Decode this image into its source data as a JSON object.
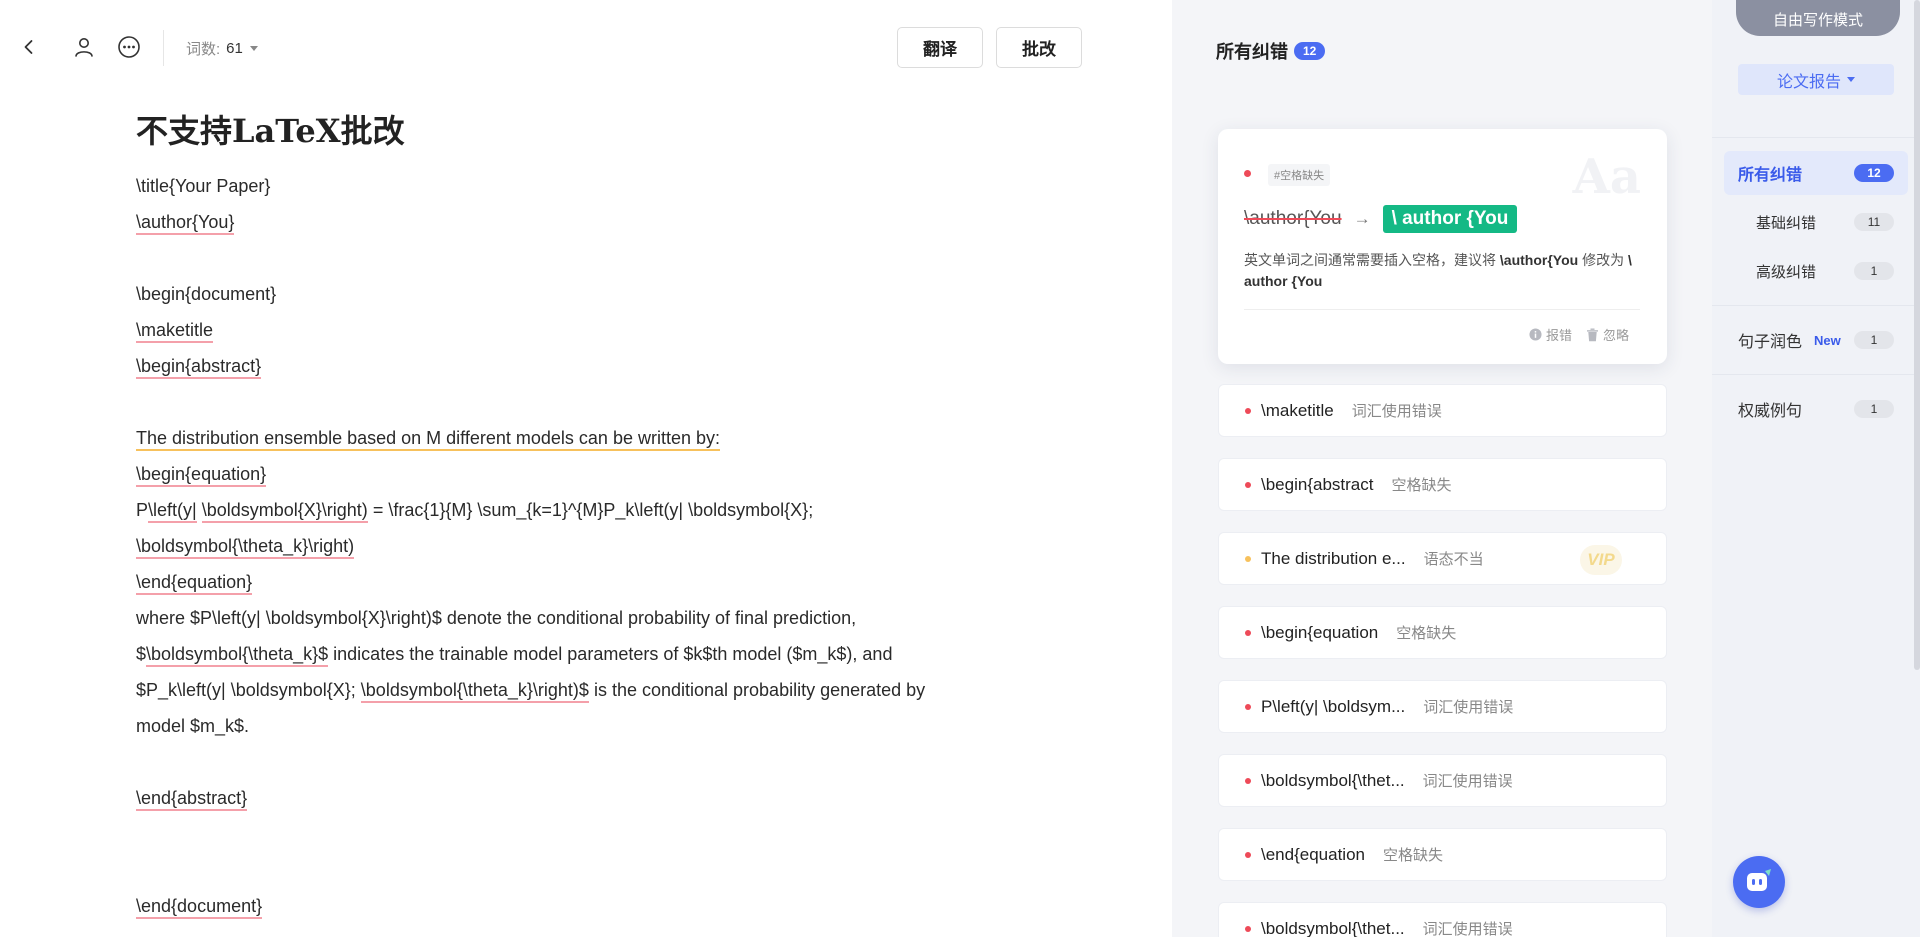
{
  "toolbar": {
    "word_count_label": "词数:",
    "word_count": "61",
    "translate_label": "翻译",
    "revise_label": "批改"
  },
  "document": {
    "title": "不支持LaTeX批改",
    "lines": [
      "\\title{Your Paper}",
      "\\author{You}",
      "",
      "\\begin{document}",
      "\\maketitle",
      "\\begin{abstract}",
      "",
      "The distribution ensemble based on M different models can be written by:",
      "\\begin{equation}",
      "P\\left(y| \\boldsymbol{X}\\right) = \\frac{1}{M} \\sum_{k=1}^{M}P_k\\left(y| \\boldsymbol{X};",
      "\\boldsymbol{\\theta_k}\\right)",
      "\\end{equation}",
      "where $P\\left(y| \\boldsymbol{X}\\right)$ denote the conditional probability of final prediction,",
      "$\\boldsymbol{\\theta_k}$ indicates the trainable model parameters of $k$th model ($m_k$), and",
      "$P_k\\left(y| \\boldsymbol{X}; \\boldsymbol{\\theta_k}\\right)$ is the conditional probability generated by",
      "model $m_k$.",
      "",
      "\\end{abstract}",
      "",
      "",
      "\\end{document}"
    ],
    "segments": {
      "l1_a": "\\title{Your Paper}",
      "l2_a": "\\author{You}",
      "l4_a": "\\begin{document}",
      "l5_a": "\\maketitle",
      "l6_a": "\\begin{abstract}",
      "l8_a": "The distribution ensemble based on M different models can be written by:",
      "l9_a": "\\begin{equation}",
      "l10_a": "P",
      "l10_b": "\\left(y|",
      "l10_c": " ",
      "l10_d": "\\boldsymbol{X}\\right)",
      "l10_e": " = \\frac{1}{M} \\sum_{k=1}^{M}P_k\\left(y| \\boldsymbol{X};",
      "l11_a": "\\boldsymbol{\\theta_k}\\right)",
      "l12_a": "\\end{equation}",
      "l13_a": "where $P\\left(y| \\boldsymbol{X}\\right)$ denote the conditional probability of final prediction,",
      "l14_a": "$",
      "l14_b": "\\boldsymbol{\\theta_k}$",
      "l14_c": " indicates the trainable model parameters of $k$th model ($m_k$), and",
      "l15_a": "$P_k\\left(y| \\boldsymbol{X}; ",
      "l15_b": "\\boldsymbol{\\theta_k}\\right)$",
      "l15_c": " is the conditional probability generated by",
      "l16_a": "model $m_k$.",
      "l18_a": "\\end{abstract}",
      "l21_a": "\\end{document}"
    }
  },
  "corrections": {
    "title": "所有纠错",
    "count": "12",
    "featured": {
      "tag": "#空格缺失",
      "original": "\\author{You",
      "suggestion": "\\ author {You",
      "desc_prefix": "英文单词之间通常需要插入空格，建议将 ",
      "desc_from": "\\author{You",
      "desc_middle": " 修改为 ",
      "desc_to": "\\ author {You",
      "report_label": "报错",
      "ignore_label": "忽略",
      "watermark": "Aa"
    },
    "items": [
      {
        "text": "\\maketitle",
        "type": "词汇使用错误"
      },
      {
        "text": "\\begin{abstract",
        "type": "空格缺失"
      },
      {
        "text": "The distribution e...",
        "type": "语态不当",
        "vip": "VIP"
      },
      {
        "text": "\\begin{equation",
        "type": "空格缺失"
      },
      {
        "text": "P\\left(y| \\boldsym...",
        "type": "词汇使用错误"
      },
      {
        "text": "\\boldsymbol{\\thet...",
        "type": "词汇使用错误"
      },
      {
        "text": "\\end{equation",
        "type": "空格缺失"
      },
      {
        "text": "\\boldsymbol{\\thet...",
        "type": "词汇使用错误"
      }
    ]
  },
  "right_nav": {
    "mode_label": "自由写作模式",
    "report_label": "论文报告",
    "items": [
      {
        "label": "所有纠错",
        "count": "12"
      },
      {
        "label": "基础纠错",
        "count": "11"
      },
      {
        "label": "高级纠错",
        "count": "1"
      },
      {
        "label": "句子润色",
        "count": "1",
        "badge": "New"
      },
      {
        "label": "权威例句",
        "count": "1"
      }
    ]
  },
  "colors": {
    "accent": "#4b6cf2",
    "error_red": "#ee4a58",
    "underline_red": "#f4a0aa",
    "underline_yellow": "#f7c15c",
    "suggestion_green": "#14b985"
  }
}
